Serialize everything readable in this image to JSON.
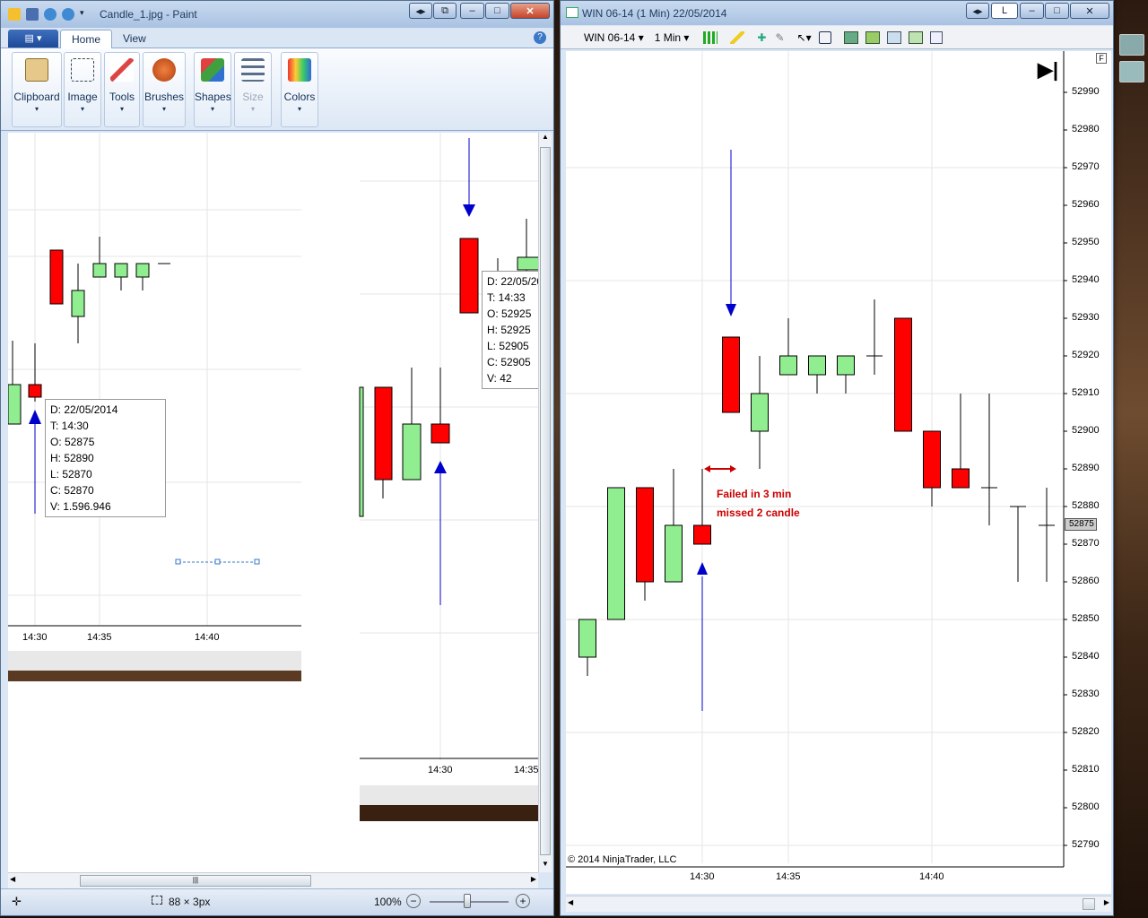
{
  "paint": {
    "title": "Candle_1.jpg - Paint",
    "tabs": {
      "home": "Home",
      "view": "View"
    },
    "groups": [
      {
        "label": "Clipboard",
        "icon": "clipboard-icon"
      },
      {
        "label": "Image",
        "icon": "image-select-icon"
      },
      {
        "label": "Tools",
        "icon": "tools-icon"
      },
      {
        "label": "Brushes",
        "icon": "brush-icon"
      },
      {
        "label": "Shapes",
        "icon": "shapes-icon"
      },
      {
        "label": "Size",
        "icon": "size-icon"
      },
      {
        "label": "Colors",
        "icon": "palette-icon"
      }
    ],
    "tooltip1": {
      "d": "D: 22/05/2014",
      "t": "T: 14:30",
      "o": "O: 52875",
      "h": "H: 52890",
      "l": "L: 52870",
      "c": "C: 52870",
      "v": "V: 1.596.946"
    },
    "tooltip2": {
      "d": "D: 22/05/20",
      "t": "T: 14:33",
      "o": "O: 52925",
      "h": "H: 52925",
      "l": "L: 52905",
      "c": "C: 52905",
      "v": "V: 42"
    },
    "left_xlabels": [
      "14:30",
      "14:35",
      "14:40"
    ],
    "right_xlabels": [
      "14:30",
      "14:35"
    ],
    "status": {
      "selection": "88 × 3px",
      "zoom": "100%"
    }
  },
  "ninja": {
    "title": "WIN 06-14 (1 Min)  22/05/2014",
    "instrument": "WIN 06-14",
    "interval": "1 Min",
    "window_btn": "L",
    "price_labels": [
      "52990",
      "52980",
      "52970",
      "52960",
      "52950",
      "52940",
      "52930",
      "52920",
      "52910",
      "52900",
      "52890",
      "52880",
      "52870",
      "52860",
      "52850",
      "52840",
      "52830",
      "52820",
      "52810",
      "52800",
      "52790"
    ],
    "current_price": "52875",
    "time_labels": [
      "14:30",
      "14:35",
      "14:40"
    ],
    "annotation1": "Failed in 3 min",
    "annotation2": "missed 2 candle",
    "copyright": "© 2014 NinjaTrader, LLC",
    "colors": {
      "up": "#90ee90",
      "down": "#ff0000",
      "arrow": "#0000cc",
      "note": "#cc0000"
    }
  },
  "chart_data": {
    "type": "candlestick",
    "title": "WIN 06-14 (1 Min)  22/05/2014",
    "ylim": [
      52785,
      52995
    ],
    "candles": [
      {
        "open": 52840,
        "high": 52850,
        "low": 52835,
        "close": 52850
      },
      {
        "open": 52850,
        "high": 52885,
        "low": 52850,
        "close": 52885
      },
      {
        "open": 52885,
        "high": 52885,
        "low": 52855,
        "close": 52860
      },
      {
        "open": 52860,
        "high": 52890,
        "low": 52860,
        "close": 52875
      },
      {
        "time": "14:30",
        "open": 52875,
        "high": 52890,
        "low": 52870,
        "close": 52870
      },
      {
        "open": 52925,
        "high": 52925,
        "low": 52905,
        "close": 52905
      },
      {
        "open": 52900,
        "high": 52920,
        "low": 52890,
        "close": 52910
      },
      {
        "open": 52915,
        "high": 52930,
        "low": 52915,
        "close": 52920
      },
      {
        "open": 52915,
        "high": 52920,
        "low": 52910,
        "close": 52920
      },
      {
        "open": 52915,
        "high": 52920,
        "low": 52910,
        "close": 52920
      },
      {
        "open": 52920,
        "high": 52935,
        "low": 52915,
        "close": 52920
      },
      {
        "open": 52930,
        "high": 52930,
        "low": 52900,
        "close": 52900
      },
      {
        "open": 52900,
        "high": 52900,
        "low": 52880,
        "close": 52885
      },
      {
        "open": 52890,
        "high": 52910,
        "low": 52885,
        "close": 52885
      },
      {
        "open": 52885,
        "high": 52910,
        "low": 52875,
        "close": 52885
      },
      {
        "open": 52880,
        "high": 52880,
        "low": 52860,
        "close": 52880
      },
      {
        "open": 52875,
        "high": 52885,
        "low": 52860,
        "close": 52875
      }
    ]
  }
}
